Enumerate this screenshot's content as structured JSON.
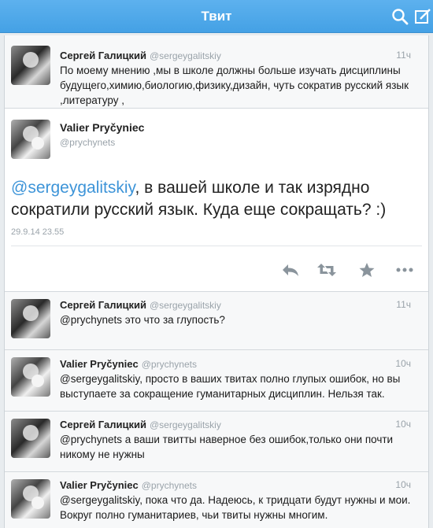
{
  "navbar": {
    "title": "Твит",
    "search_icon": "search-icon",
    "compose_icon": "compose-icon",
    "bg_color": "#4aa6e9"
  },
  "detail_tweet": {
    "name": "Valier Pryčyniec",
    "handle": "@prychynets",
    "mention": "@sergeygalitskiy",
    "text_rest": ", в вашей школе и так изрядно сократили русский язык. Куда еще сокращать? :)",
    "date": "29.9.14 23.55",
    "actions": [
      "reply-icon",
      "retweet-icon",
      "favorite-icon",
      "more-icon"
    ]
  },
  "tweets": [
    {
      "name": "Сергей Галицкий",
      "handle": "@sergeygalitskiy",
      "time": "11ч",
      "text": "По моему мнению ,мы в школе должны больше изучать дисциплины будущего,химию,биологию,физику,дизайн, чуть сократив русский язык ,литературу ,"
    },
    {
      "name": "Сергей Галицкий",
      "handle": "@sergeygalitskiy",
      "time": "11ч",
      "text": "@prychynets это что за глупость?"
    },
    {
      "name": "Valier Pryčyniec",
      "handle": "@prychynets",
      "time": "10ч",
      "text": "@sergeygalitskiy, просто в ваших твитах полно глупых ошибок, но вы выступаете за сокращение гуманитарных дисциплин. Нельзя так."
    },
    {
      "name": "Сергей Галицкий",
      "handle": "@sergeygalitskiy",
      "time": "10ч",
      "text": "@prychynets а ваши твитты наверное без ошибок,только они почти никому не нужны"
    },
    {
      "name": "Valier Pryčyniec",
      "handle": "@prychynets",
      "time": "10ч",
      "text": "@sergeygalitskiy, пока что да. Надеюсь, к тридцати будут нужны и мои. Вокруг полно гуманитариев, чьи твиты нужны многим."
    }
  ],
  "colors": {
    "mention": "#3d94d8",
    "muted": "#9aa3aa",
    "icon_gray": "#8a949c"
  }
}
